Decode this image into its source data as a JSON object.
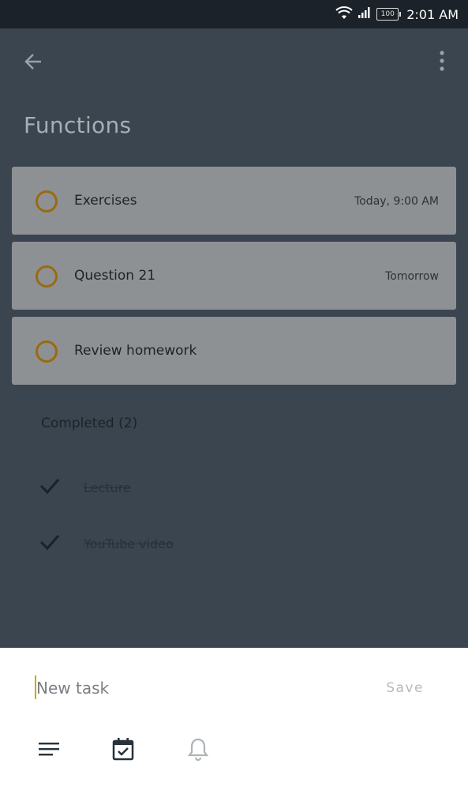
{
  "status": {
    "time": "2:01 AM",
    "battery": "100"
  },
  "header": {
    "title": "Functions"
  },
  "tasks": [
    {
      "name": "Exercises",
      "due": "Today, 9:00 AM"
    },
    {
      "name": "Question 21",
      "due": "Tomorrow"
    },
    {
      "name": "Review homework",
      "due": ""
    }
  ],
  "completed": {
    "heading": "Completed (2)",
    "items": [
      {
        "name": "Lecture"
      },
      {
        "name": "YouTube video"
      }
    ]
  },
  "new_task": {
    "placeholder": "New task",
    "save_label": "Save"
  },
  "icons": [
    "wifi-icon",
    "signal-icon",
    "battery-icon",
    "back-arrow-icon",
    "more-vert-icon",
    "check-icon",
    "notes-icon",
    "calendar-check-icon",
    "bell-icon"
  ],
  "colors": {
    "accent": "#d4a20a",
    "circle": "#9a6a12",
    "scrim": "#3b4550"
  }
}
